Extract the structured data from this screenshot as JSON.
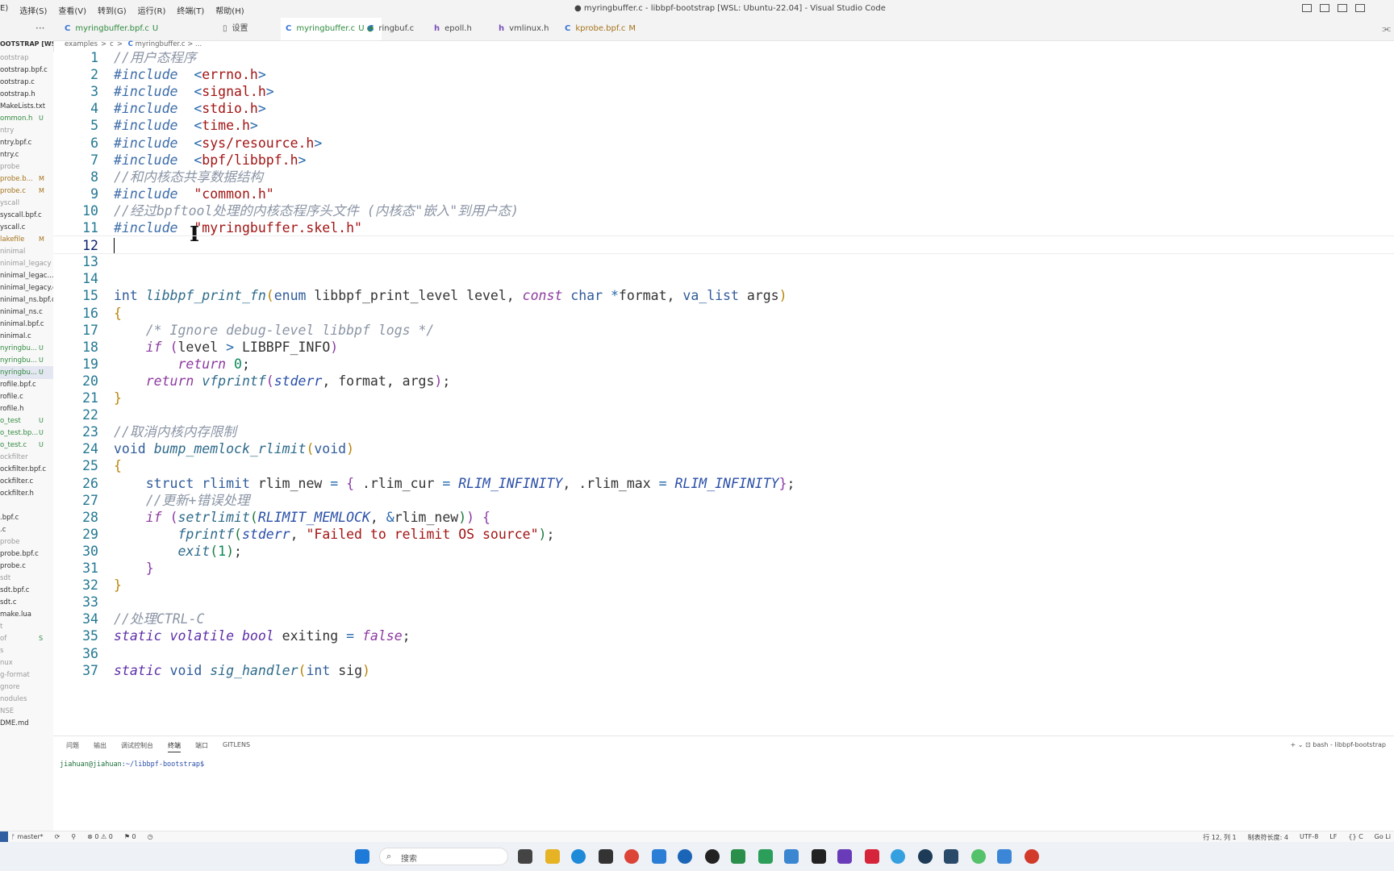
{
  "window_title": "● myringbuffer.c - libbpf-bootstrap [WSL: Ubuntu-22.04] - Visual Studio Code",
  "menu": [
    "E)",
    "选择(S)",
    "查看(V)",
    "转到(G)",
    "运行(R)",
    "终端(T)",
    "帮助(H)"
  ],
  "tabs": [
    {
      "icon": "C",
      "label": "myringbuffer.bpf.c",
      "status": "U",
      "active": false
    },
    {
      "icon": "▯",
      "label": "设置",
      "status": "",
      "active": false
    },
    {
      "icon": "C",
      "label": "myringbuffer.c",
      "status": "U ●",
      "active": true
    },
    {
      "icon": "C",
      "label": "ringbuf.c",
      "status": "",
      "active": false
    },
    {
      "icon": "h",
      "label": "epoll.h",
      "status": "",
      "active": false
    },
    {
      "icon": "h",
      "label": "vmlinux.h",
      "status": "",
      "active": false
    },
    {
      "icon": "C",
      "label": "kprobe.bpf.c",
      "status": "M",
      "active": false
    }
  ],
  "explorer": {
    "more": "···",
    "header": "OOTSTRAP [WSL:...",
    "items": [
      {
        "name": "ootstrap",
        "status": ""
      },
      {
        "name": "ootstrap.bpf.c",
        "status": ""
      },
      {
        "name": "ootstrap.c",
        "status": ""
      },
      {
        "name": "ootstrap.h",
        "status": ""
      },
      {
        "name": "MakeLists.txt",
        "status": ""
      },
      {
        "name": "ommon.h",
        "status": "U"
      },
      {
        "name": "ntry",
        "status": ""
      },
      {
        "name": "ntry.bpf.c",
        "status": ""
      },
      {
        "name": "ntry.c",
        "status": ""
      },
      {
        "name": "probe",
        "status": ""
      },
      {
        "name": "probe.b...",
        "status": "M"
      },
      {
        "name": "probe.c",
        "status": "M"
      },
      {
        "name": "yscall",
        "status": ""
      },
      {
        "name": "syscall.bpf.c",
        "status": ""
      },
      {
        "name": "yscall.c",
        "status": ""
      },
      {
        "name": "lakefile",
        "status": "M"
      },
      {
        "name": "ninimal",
        "status": ""
      },
      {
        "name": "ninimal_legacy",
        "status": ""
      },
      {
        "name": "ninimal_legac...",
        "status": ""
      },
      {
        "name": "ninimal_legacy.c",
        "status": ""
      },
      {
        "name": "ninimal_ns.bpf.c",
        "status": ""
      },
      {
        "name": "ninimal_ns.c",
        "status": ""
      },
      {
        "name": "ninimal.bpf.c",
        "status": ""
      },
      {
        "name": "ninimal.c",
        "status": ""
      },
      {
        "name": "nyringbu...",
        "status": "U"
      },
      {
        "name": "nyringbu...",
        "status": "U"
      },
      {
        "name": "nyringbu...",
        "status": "U"
      },
      {
        "name": "rofile.bpf.c",
        "status": ""
      },
      {
        "name": "rofile.c",
        "status": ""
      },
      {
        "name": "rofile.h",
        "status": ""
      },
      {
        "name": "o_test",
        "status": "U"
      },
      {
        "name": "o_test.bp...",
        "status": "U"
      },
      {
        "name": "o_test.c",
        "status": "U"
      },
      {
        "name": "ockfilter",
        "status": ""
      },
      {
        "name": "ockfilter.bpf.c",
        "status": ""
      },
      {
        "name": "ockfilter.c",
        "status": ""
      },
      {
        "name": "ockfilter.h",
        "status": ""
      },
      {
        "name": "",
        "status": ""
      },
      {
        "name": ".bpf.c",
        "status": ""
      },
      {
        "name": ".c",
        "status": ""
      },
      {
        "name": "probe",
        "status": ""
      },
      {
        "name": "probe.bpf.c",
        "status": ""
      },
      {
        "name": "probe.c",
        "status": ""
      },
      {
        "name": "sdt",
        "status": ""
      },
      {
        "name": "sdt.bpf.c",
        "status": ""
      },
      {
        "name": "sdt.c",
        "status": ""
      },
      {
        "name": "make.lua",
        "status": ""
      },
      {
        "name": "t",
        "status": ""
      },
      {
        "name": "of",
        "status": "S"
      },
      {
        "name": "s",
        "status": ""
      },
      {
        "name": "nux",
        "status": ""
      },
      {
        "name": "g-format",
        "status": ""
      },
      {
        "name": "gnore",
        "status": ""
      },
      {
        "name": "nodules",
        "status": ""
      },
      {
        "name": "NSE",
        "status": ""
      },
      {
        "name": "DME.md",
        "status": ""
      }
    ]
  },
  "breadcrumb": {
    "parts": [
      "examples",
      ">",
      "c",
      ">"
    ],
    "file_icon": "C",
    "file": "myringbuffer.c",
    "tail": "> ..."
  },
  "code_lines": [
    [
      [
        "cm",
        "//用户态程序"
      ]
    ],
    [
      [
        "pp",
        "#include"
      ],
      [
        "",
        "  "
      ],
      [
        "op",
        "<"
      ],
      [
        "str",
        "errno.h"
      ],
      [
        "op",
        ">"
      ]
    ],
    [
      [
        "pp",
        "#include"
      ],
      [
        "",
        "  "
      ],
      [
        "op",
        "<"
      ],
      [
        "str",
        "signal.h"
      ],
      [
        "op",
        ">"
      ]
    ],
    [
      [
        "pp",
        "#include"
      ],
      [
        "",
        "  "
      ],
      [
        "op",
        "<"
      ],
      [
        "str",
        "stdio.h"
      ],
      [
        "op",
        ">"
      ]
    ],
    [
      [
        "pp",
        "#include"
      ],
      [
        "",
        "  "
      ],
      [
        "op",
        "<"
      ],
      [
        "str",
        "time.h"
      ],
      [
        "op",
        ">"
      ]
    ],
    [
      [
        "pp",
        "#include"
      ],
      [
        "",
        "  "
      ],
      [
        "op",
        "<"
      ],
      [
        "str",
        "sys/resource.h"
      ],
      [
        "op",
        ">"
      ]
    ],
    [
      [
        "pp",
        "#include"
      ],
      [
        "",
        "  "
      ],
      [
        "op",
        "<"
      ],
      [
        "str",
        "bpf/libbpf.h"
      ],
      [
        "op",
        ">"
      ]
    ],
    [
      [
        "cm",
        "//和内核态共享数据结构"
      ]
    ],
    [
      [
        "pp",
        "#include"
      ],
      [
        "",
        "  "
      ],
      [
        "str",
        "\"common.h\""
      ]
    ],
    [
      [
        "cm",
        "//经过bpftool处理的内核态程序头文件 (内核态\"嵌入\"到用户态)"
      ]
    ],
    [
      [
        "pp",
        "#include"
      ],
      [
        "",
        "  "
      ],
      [
        "str",
        "\"myringbuffer.skel.h\""
      ]
    ],
    [],
    [],
    [],
    [
      [
        "ty",
        "int"
      ],
      [
        "",
        " "
      ],
      [
        "fn",
        "libbpf_print_fn"
      ],
      [
        "br1",
        "("
      ],
      [
        "ty",
        "enum"
      ],
      [
        "",
        " libbpf_print_level level, "
      ],
      [
        "kw",
        "const"
      ],
      [
        "",
        " "
      ],
      [
        "ty",
        "char"
      ],
      [
        "",
        " "
      ],
      [
        "op",
        "*"
      ],
      [
        "",
        "format, "
      ],
      [
        "ty",
        "va_list"
      ],
      [
        "",
        " args"
      ],
      [
        "br1",
        ")"
      ]
    ],
    [
      [
        "br1",
        "{"
      ]
    ],
    [
      [
        "",
        "    "
      ],
      [
        "cm",
        "/* Ignore debug-level libbpf logs */"
      ]
    ],
    [
      [
        "",
        "    "
      ],
      [
        "kw",
        "if"
      ],
      [
        "",
        " "
      ],
      [
        "br2",
        "("
      ],
      [
        "",
        "level "
      ],
      [
        "op",
        ">"
      ],
      [
        "",
        " LIBBPF_INFO"
      ],
      [
        "br2",
        ")"
      ]
    ],
    [
      [
        "",
        "        "
      ],
      [
        "kw",
        "return"
      ],
      [
        "",
        " "
      ],
      [
        "num",
        "0"
      ],
      [
        "",
        ";"
      ]
    ],
    [
      [
        "",
        "    "
      ],
      [
        "kw",
        "return"
      ],
      [
        "",
        " "
      ],
      [
        "fn",
        "vfprintf"
      ],
      [
        "br2",
        "("
      ],
      [
        "mac",
        "stderr"
      ],
      [
        "",
        ", format, args"
      ],
      [
        "br2",
        ")"
      ],
      [
        "",
        ";"
      ]
    ],
    [
      [
        "br1",
        "}"
      ]
    ],
    [],
    [
      [
        "cm",
        "//取消内核内存限制"
      ]
    ],
    [
      [
        "ty",
        "void"
      ],
      [
        "",
        " "
      ],
      [
        "fn",
        "bump_memlock_rlimit"
      ],
      [
        "br1",
        "("
      ],
      [
        "ty",
        "void"
      ],
      [
        "br1",
        ")"
      ]
    ],
    [
      [
        "br1",
        "{"
      ]
    ],
    [
      [
        "",
        "    "
      ],
      [
        "ty",
        "struct"
      ],
      [
        "",
        " "
      ],
      [
        "ty",
        "rlimit"
      ],
      [
        "",
        " rlim_new "
      ],
      [
        "op",
        "="
      ],
      [
        "",
        " "
      ],
      [
        "br2",
        "{"
      ],
      [
        "",
        " .rlim_cur "
      ],
      [
        "op",
        "="
      ],
      [
        "",
        " "
      ],
      [
        "mac",
        "RLIM_INFINITY"
      ],
      [
        "",
        ", .rlim_max "
      ],
      [
        "op",
        "="
      ],
      [
        "",
        " "
      ],
      [
        "mac",
        "RLIM_INFINITY"
      ],
      [
        "br2",
        "}"
      ],
      [
        "",
        ";"
      ]
    ],
    [
      [
        "",
        "    "
      ],
      [
        "cm",
        "//更新+错误处理"
      ]
    ],
    [
      [
        "",
        "    "
      ],
      [
        "kw",
        "if"
      ],
      [
        "",
        " "
      ],
      [
        "br2",
        "("
      ],
      [
        "fn",
        "setrlimit"
      ],
      [
        "br3",
        "("
      ],
      [
        "mac",
        "RLIMIT_MEMLOCK"
      ],
      [
        "",
        ", "
      ],
      [
        "op",
        "&"
      ],
      [
        "",
        "rlim_new"
      ],
      [
        "br3",
        ")"
      ],
      [
        "br2",
        ")"
      ],
      [
        "",
        " "
      ],
      [
        "br2",
        "{"
      ]
    ],
    [
      [
        "",
        "        "
      ],
      [
        "fn",
        "fprintf"
      ],
      [
        "br3",
        "("
      ],
      [
        "mac",
        "stderr"
      ],
      [
        "",
        ", "
      ],
      [
        "str",
        "\"Failed to relimit OS source\""
      ],
      [
        "br3",
        ")"
      ],
      [
        "",
        ";"
      ]
    ],
    [
      [
        "",
        "        "
      ],
      [
        "fn",
        "exit"
      ],
      [
        "br3",
        "("
      ],
      [
        "num",
        "1"
      ],
      [
        "br3",
        ")"
      ],
      [
        "",
        ";"
      ]
    ],
    [
      [
        "",
        "    "
      ],
      [
        "br2",
        "}"
      ]
    ],
    [
      [
        "br1",
        "}"
      ]
    ],
    [],
    [
      [
        "cm",
        "//处理CTRL-C"
      ]
    ],
    [
      [
        "tyi",
        "static"
      ],
      [
        "",
        " "
      ],
      [
        "tyi",
        "volatile"
      ],
      [
        "",
        " "
      ],
      [
        "tyi",
        "bool"
      ],
      [
        "",
        " exiting "
      ],
      [
        "op",
        "="
      ],
      [
        "",
        " "
      ],
      [
        "kw",
        "false"
      ],
      [
        "",
        ";"
      ]
    ],
    [],
    [
      [
        "tyi",
        "static"
      ],
      [
        "",
        " "
      ],
      [
        "ty",
        "void"
      ],
      [
        "",
        " "
      ],
      [
        "fn",
        "sig_handler"
      ],
      [
        "br1",
        "("
      ],
      [
        "ty",
        "int"
      ],
      [
        "",
        " sig"
      ],
      [
        "br1",
        ")"
      ]
    ]
  ],
  "current_line": 12,
  "panel": {
    "tabs": [
      "问题",
      "输出",
      "调试控制台",
      "终端",
      "端口",
      "GITLENS"
    ],
    "active_tab": "终端",
    "right": "+ ⌄   ⊡ bash - libbpf-bootstrap",
    "prompt_user": "jiahuan@jiahuan",
    "prompt_path": ":~/libbpf-bootstrap$"
  },
  "statusbar": {
    "left": [
      "ᚠ master*",
      "⟳",
      "⚲",
      "⊗ 0 ⚠ 0",
      "⚑ 0",
      "◷"
    ],
    "right": [
      "行 12, 列 1",
      "制表符长度: 4",
      "UTF-8",
      "LF",
      "{} C",
      "Go Li"
    ]
  },
  "taskbar": {
    "search_placeholder": "搜索"
  },
  "colors": {
    "accent": "#2f5fa0",
    "comment": "#8b95a5",
    "string": "#a31515",
    "keyword": "#8d3aa0"
  }
}
